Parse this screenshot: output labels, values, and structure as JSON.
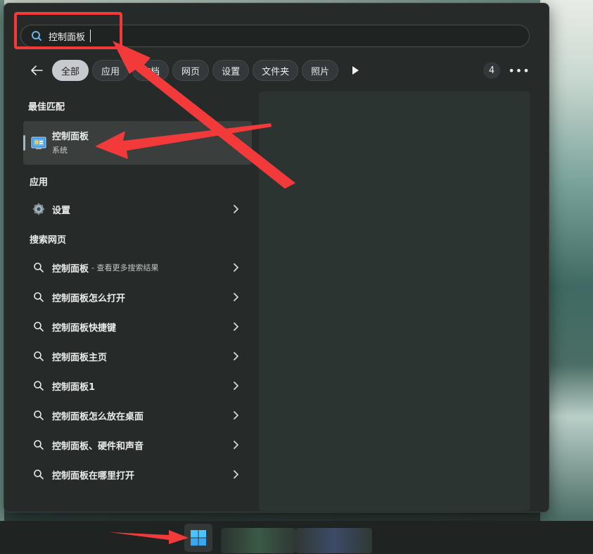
{
  "search": {
    "value": "控制面板",
    "placeholder": ""
  },
  "filters": {
    "items": [
      {
        "label": "全部",
        "active": true
      },
      {
        "label": "应用",
        "active": false
      },
      {
        "label": "文档",
        "active": false
      },
      {
        "label": "网页",
        "active": false
      },
      {
        "label": "设置",
        "active": false
      },
      {
        "label": "文件夹",
        "active": false
      },
      {
        "label": "照片",
        "active": false
      }
    ],
    "count": "4",
    "more": "•••"
  },
  "best_match": {
    "heading": "最佳匹配",
    "title": "控制面板",
    "subtitle": "系统"
  },
  "apps": {
    "heading": "应用",
    "items": [
      {
        "label": "设置",
        "icon": "gear-icon"
      }
    ]
  },
  "web": {
    "heading": "搜索网页",
    "items": [
      {
        "label": "控制面板",
        "hint": "- 查看更多搜索结果"
      },
      {
        "label": "控制面板怎么打开"
      },
      {
        "label": "控制面板快捷键"
      },
      {
        "label": "控制面板主页"
      },
      {
        "label": "控制面板1"
      },
      {
        "label": "控制面板怎么放在桌面"
      },
      {
        "label": "控制面板、硬件和声音"
      },
      {
        "label": "控制面板在哪里打开"
      }
    ]
  },
  "colors": {
    "accent": "#f23a3a",
    "panel": "#262b29",
    "chip_active": "#c7cbd0"
  }
}
